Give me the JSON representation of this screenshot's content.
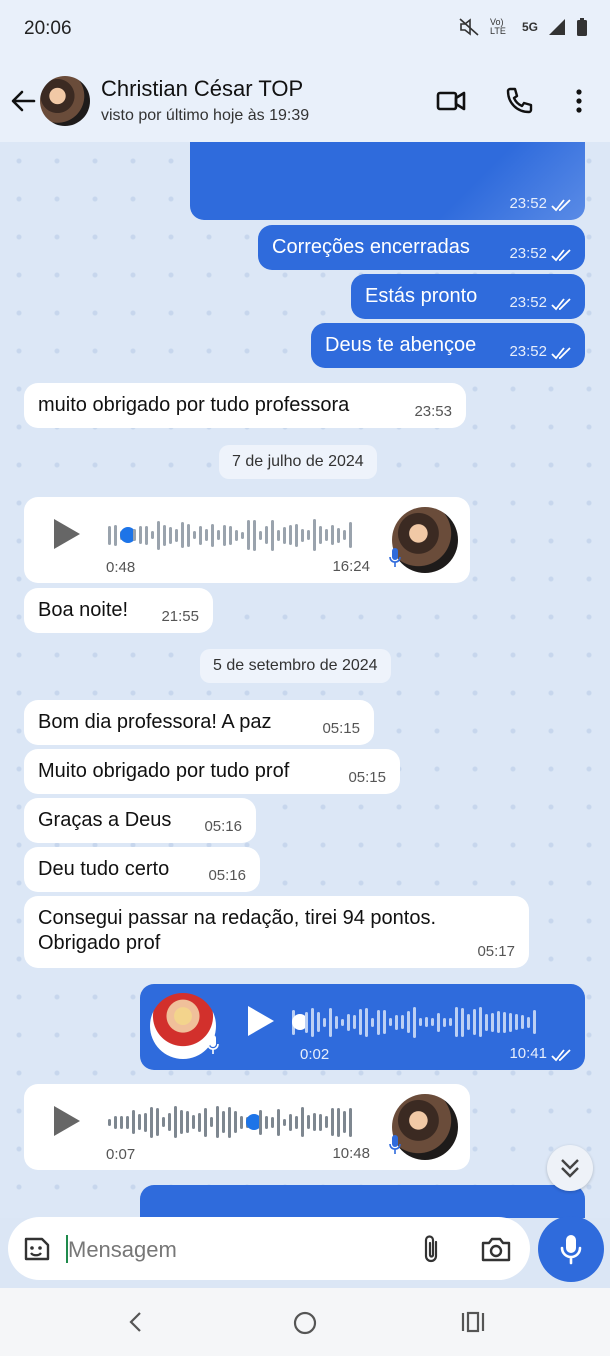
{
  "status": {
    "time": "20:06",
    "network": "5G",
    "volte": "Vo) LTE"
  },
  "header": {
    "contact_name": "Christian César TOP",
    "last_seen": "visto por último hoje às 19:39"
  },
  "messages": [
    {
      "dir": "out",
      "time": "23:52"
    },
    {
      "dir": "out",
      "text": "Correções encerradas",
      "time": "23:52"
    },
    {
      "dir": "out",
      "text": "Estás pronto",
      "time": "23:52"
    },
    {
      "dir": "out",
      "text": "Deus te abençoe",
      "time": "23:52"
    },
    {
      "dir": "in",
      "text": "muito obrigado por tudo professora",
      "time": "23:53"
    },
    {
      "date": "7 de julho de 2024"
    },
    {
      "dir": "in",
      "voice": true,
      "duration": "0:48",
      "time": "16:24"
    },
    {
      "dir": "in",
      "text": "Boa noite!",
      "time": "21:55"
    },
    {
      "date": "5 de setembro de 2024"
    },
    {
      "dir": "in",
      "text": "Bom dia professora! A paz",
      "time": "05:15"
    },
    {
      "dir": "in",
      "text": "Muito obrigado por tudo prof",
      "time": "05:15"
    },
    {
      "dir": "in",
      "text": "Graças a Deus",
      "time": "05:16"
    },
    {
      "dir": "in",
      "text": "Deu tudo certo",
      "time": "05:16"
    },
    {
      "dir": "in",
      "text_line1": "Consegui passar na redação, tirei 94 pontos.",
      "text_line2": "Obrigado prof",
      "time": "05:17"
    },
    {
      "dir": "out",
      "voice": true,
      "duration": "0:02",
      "time": "10:41"
    },
    {
      "dir": "in",
      "voice": true,
      "duration": "0:07",
      "time": "10:48"
    }
  ],
  "composer": {
    "placeholder": "Mensagem"
  },
  "icons": [
    "back-arrow-icon",
    "video-call-icon",
    "phone-icon",
    "more-icon",
    "emoji-icon",
    "attach-icon",
    "camera-icon",
    "mic-icon",
    "play-icon",
    "read-ticks-icon",
    "chevron-double-down-icon"
  ],
  "colors": {
    "accent": "#2f6bdc",
    "incoming": "#ffffff",
    "background": "#dce7f6"
  }
}
